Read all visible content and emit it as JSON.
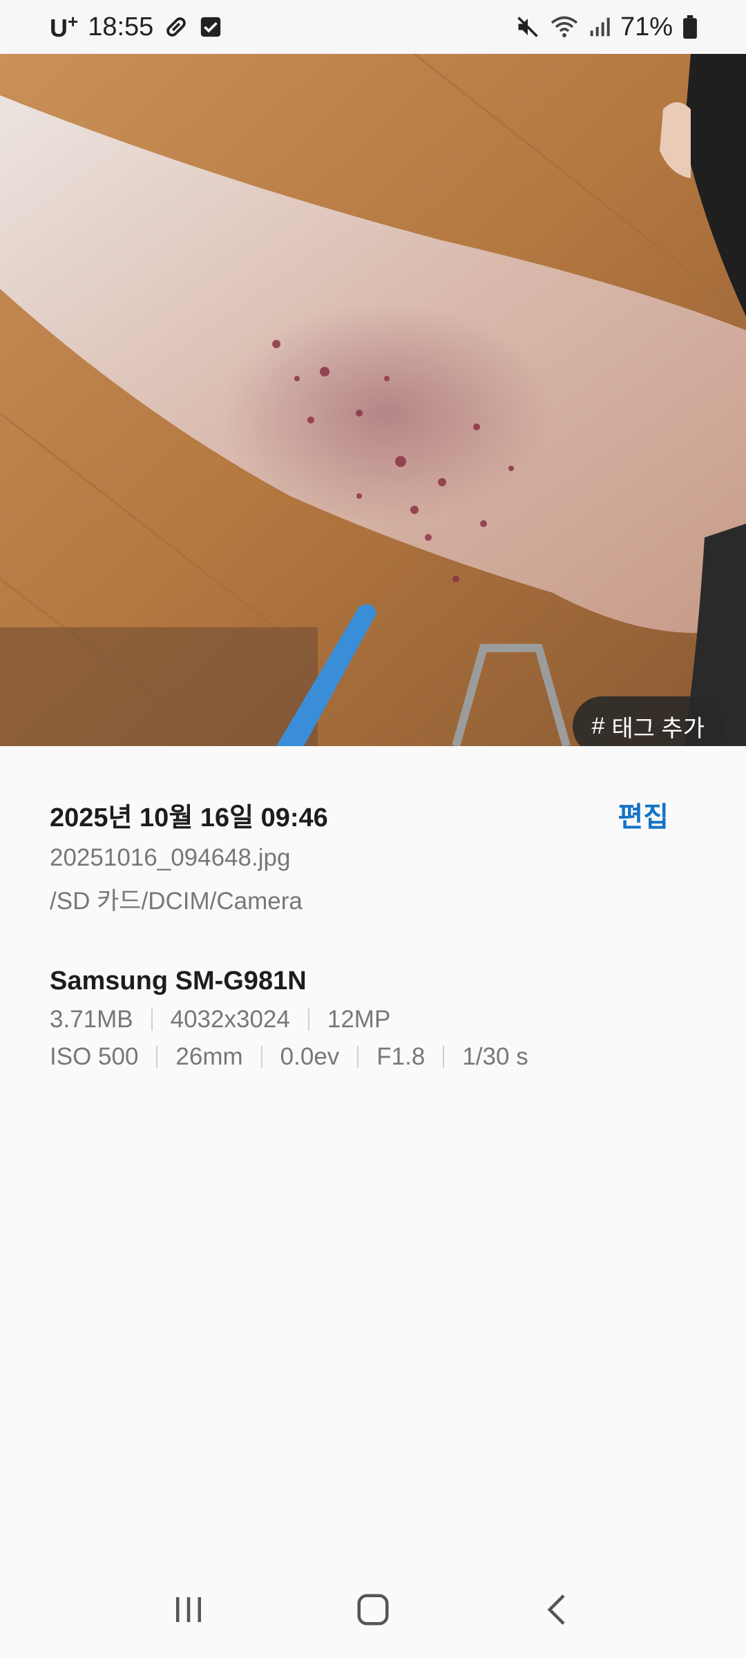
{
  "status_bar": {
    "carrier": "U",
    "carrier_suffix": "+",
    "time": "18:55",
    "icons_left": [
      "pill-icon",
      "checkbox-icon"
    ],
    "icons_right": [
      "mute-icon",
      "wifi-icon",
      "signal-icon",
      "battery-icon"
    ],
    "battery": "71%"
  },
  "photo": {
    "tag_button_label": "태그 추가",
    "tag_icon": "#"
  },
  "details": {
    "date": "2025년 10월 16일 09:46",
    "edit_label": "편집",
    "filename": "20251016_094648.jpg",
    "path": "/SD 카드/DCIM/Camera",
    "device": "Samsung SM-G981N",
    "specs_row1": [
      "3.71MB",
      "4032x3024",
      "12MP"
    ],
    "specs_row2": [
      "ISO 500",
      "26mm",
      "0.0ev",
      "F1.8",
      "1/30 s"
    ]
  },
  "nav": {
    "buttons": [
      "recents-icon",
      "home-icon",
      "back-icon"
    ]
  },
  "colors": {
    "accent": "#1674c4",
    "background": "#fafafa",
    "floor": "#b47a3e",
    "skin": "#ddbfb0"
  }
}
